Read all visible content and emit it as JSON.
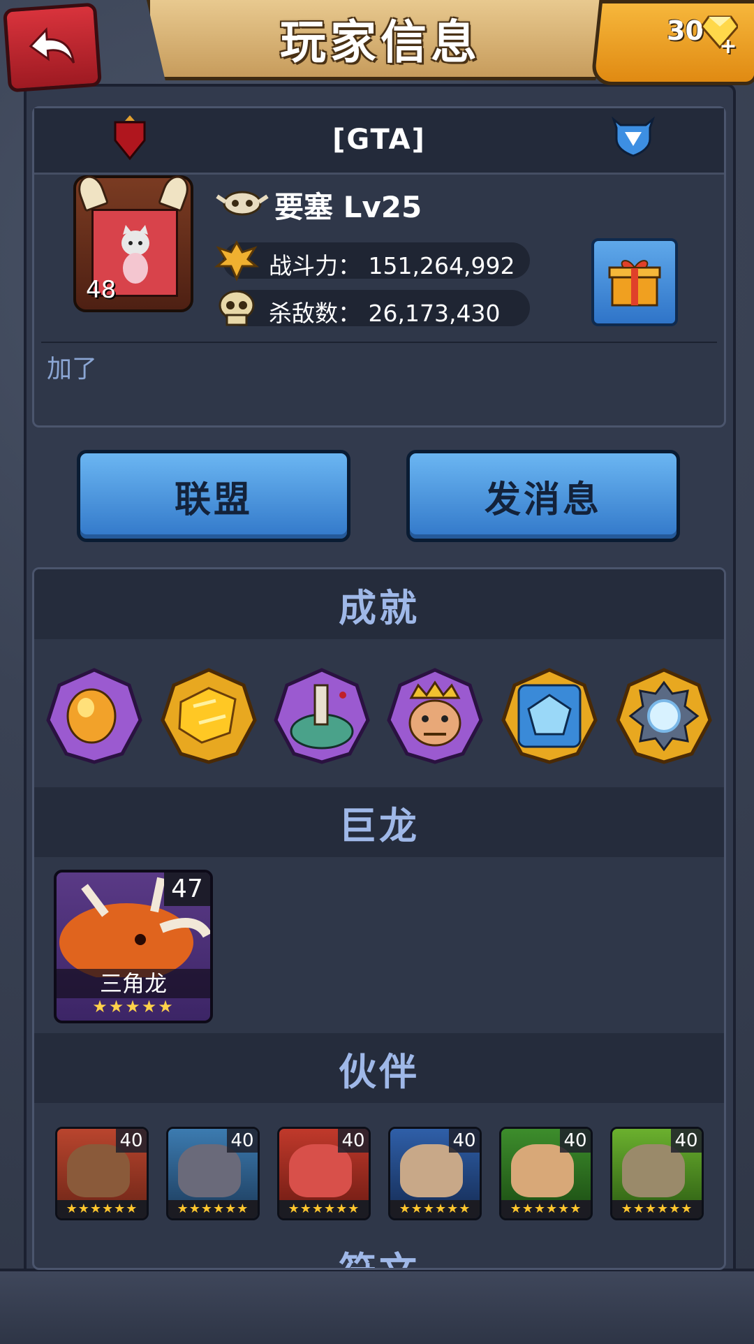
{
  "header": {
    "title": "玩家信息",
    "currency_amount": "30"
  },
  "profile": {
    "guild_tag": "[GTA]",
    "avatar_level": "48",
    "player_name": "要塞 Lv25",
    "power_label": "战斗力：",
    "power_value": "151,264,992",
    "kills_label": "杀敌数：",
    "kills_value": "26,173,430",
    "signature": "加了"
  },
  "actions": {
    "alliance": "联盟",
    "message": "发消息"
  },
  "sections": {
    "achievements": "成就",
    "dragons": "巨龙",
    "partners": "伙伴",
    "next": "符文"
  },
  "achievements": [
    {
      "icon": "amber-gem-icon",
      "frame": "purple"
    },
    {
      "icon": "gold-ore-icon",
      "frame": "gold"
    },
    {
      "icon": "zombie-hand-icon",
      "frame": "purple"
    },
    {
      "icon": "king-face-icon",
      "frame": "purple"
    },
    {
      "icon": "ice-beast-icon",
      "frame": "gold"
    },
    {
      "icon": "gear-orb-icon",
      "frame": "gold"
    }
  ],
  "dragon": {
    "name": "三角龙",
    "level": "47",
    "stars": "★★★★★"
  },
  "partners": [
    {
      "level": "40",
      "stars": "★★★★★★",
      "color": "#b9452e"
    },
    {
      "level": "40",
      "stars": "★★★★★★",
      "color": "#3c7bb0"
    },
    {
      "level": "40",
      "stars": "★★★★★★",
      "color": "#c0392b"
    },
    {
      "level": "40",
      "stars": "★★★★★★",
      "color": "#2f5fa8"
    },
    {
      "level": "40",
      "stars": "★★★★★★",
      "color": "#3d8d2c"
    },
    {
      "level": "40",
      "stars": "★★★★★★",
      "color": "#6bb02e"
    }
  ],
  "colors": {
    "accent_blue": "#3278c9",
    "section_title": "#9fb8e8",
    "currency_gold": "#f6b73c"
  }
}
